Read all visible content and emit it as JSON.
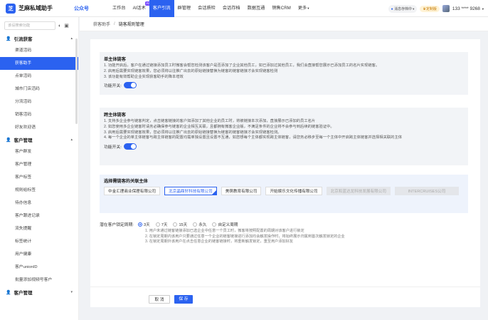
{
  "app": {
    "name": "芝麻私域助手",
    "logo_glyph": "芝",
    "link": "公众号"
  },
  "nav": {
    "items": [
      "工作台",
      "AI话术",
      "客户引流",
      "群管理",
      "会话质检",
      "会话存档",
      "数据互通",
      "销售CRM",
      "更多"
    ],
    "active_index": 2,
    "ai_badge": "AI"
  },
  "topright": {
    "status": "消息存档中",
    "vip": "定制版",
    "phone": "133 **** 9268"
  },
  "sidebar": {
    "search_placeholder": "该设搜索功能",
    "groups": [
      {
        "title": "引流获客",
        "items": [
          "渠道活码",
          "获客助手",
          "点单活码",
          "城市门店活码",
          "分流活码",
          "销客活码",
          "好友欢迎语"
        ]
      },
      {
        "title": "客户管理",
        "items": [
          "客户群发",
          "客户管理",
          "客户标签",
          "规则给标签",
          "待办信息",
          "客户跟进记录",
          "流失提醒",
          "标签统计",
          "用户健康",
          "客户unionID",
          "批量添加视频号客户"
        ]
      },
      {
        "title": "客户管理",
        "items": []
      }
    ],
    "active_item": "获客助手"
  },
  "breadcrumb": [
    "获客助手",
    "链客规则管理"
  ],
  "single": {
    "title": "单主体链客",
    "lines": [
      "1. 功能开启后，客户在通过链接添加员工时微客会帮您检测该客户是否添加了企业其他员工，如已添加过其他员工，我们会直接帮您展示已添加员工的名片实现链客。",
      "2. 启用后需要实现链客效果，您必须将以往推广出去的原始链接替换为链客的链客链接才会实现链客检测",
      "3. 该功能有效帮助企业实现获客助手的降本增效"
    ],
    "toggle_label": "功能开关:"
  },
  "cross": {
    "title": "跨主体链客",
    "lines": [
      "1. 支持多企业参与链客判定，点击链客链接的客户如添加了其他企业的员工时，将被链接本次添加，直接展示已添加的员工名片",
      "2. 如您使用多企业链客时请务必确保参与链客的企业相互关联，且都拥有微客企业版，不满足条件的企业将不会参与到后续的链客验证中。",
      "3. 启用后需要实现链客效果，您必须将以往推广出去的原始链接替换为链客的链客链接才会实现链客检测。",
      "4. 每一个企业的单主体链客与跨主体链客的配置均需单独设置且设置不互通，如您想每个主体都实现跨主体链客，请您务必移步至每一个主体中开启跨主体链客并选择相关联的主体"
    ],
    "toggle_label": "功能开关:"
  },
  "entities": {
    "title": "选择需链客的关联主体",
    "items": [
      {
        "name": "中金汇理商业保理有限公司",
        "state": "normal"
      },
      {
        "name": "北京晶鼎轩科技有限公司",
        "state": "selected"
      },
      {
        "name": "美萌教育有限公司",
        "state": "normal"
      },
      {
        "name": "开始娱乐文化传播有限公司",
        "state": "normal"
      },
      {
        "name": "北京和蓝达龙科技发展有限公司",
        "state": "disabled"
      },
      {
        "name": "INTERCRUISES公司",
        "state": "disabled"
      }
    ]
  },
  "period": {
    "label": "潜在客户锁定周期:",
    "options": [
      "3天",
      "7天",
      "15天",
      "永久",
      "自定义周期"
    ],
    "selected_index": 0,
    "notes": [
      "1. 用户未通过链客链接添加已选企业中任意一个员工时，微客将按照配置的周期对该客户进行锁定",
      "2. 在锁定周期内该用户只要通过任意一个企业的链客链接进行添加均会触发操作时，将始终展示归属到首次触发锁定的企业",
      "3. 在锁定周期外该用户在点击任意企业的链客链接时，将重新触发锁定，重至用户添加好友"
    ]
  },
  "buttons": {
    "cancel": "取 消",
    "save": "保 存"
  }
}
